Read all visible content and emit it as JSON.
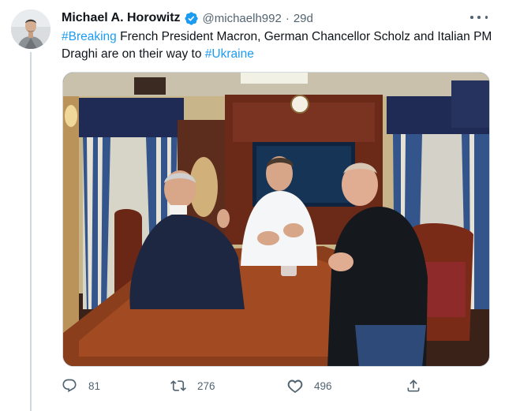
{
  "author": {
    "name": "Michael A. Horowitz",
    "handle": "@michaelh992",
    "separator": "·",
    "time": "29d"
  },
  "tweet": {
    "hashtag_1": "#Breaking",
    "text_1": " French President Macron, German Chancellor Scholz and Italian PM Draghi are on their way to ",
    "hashtag_2": "#Ukraine"
  },
  "actions": {
    "replies": "81",
    "retweets": "276",
    "likes": "496"
  },
  "icons": {
    "verified": "verified-badge-icon",
    "more": "more-horizontal-icon",
    "reply": "reply-icon",
    "retweet": "retweet-icon",
    "like": "heart-icon",
    "share": "share-icon"
  },
  "colors": {
    "link": "#1d9bf0",
    "secondary_text": "#536471",
    "primary_text": "#0f1419"
  }
}
